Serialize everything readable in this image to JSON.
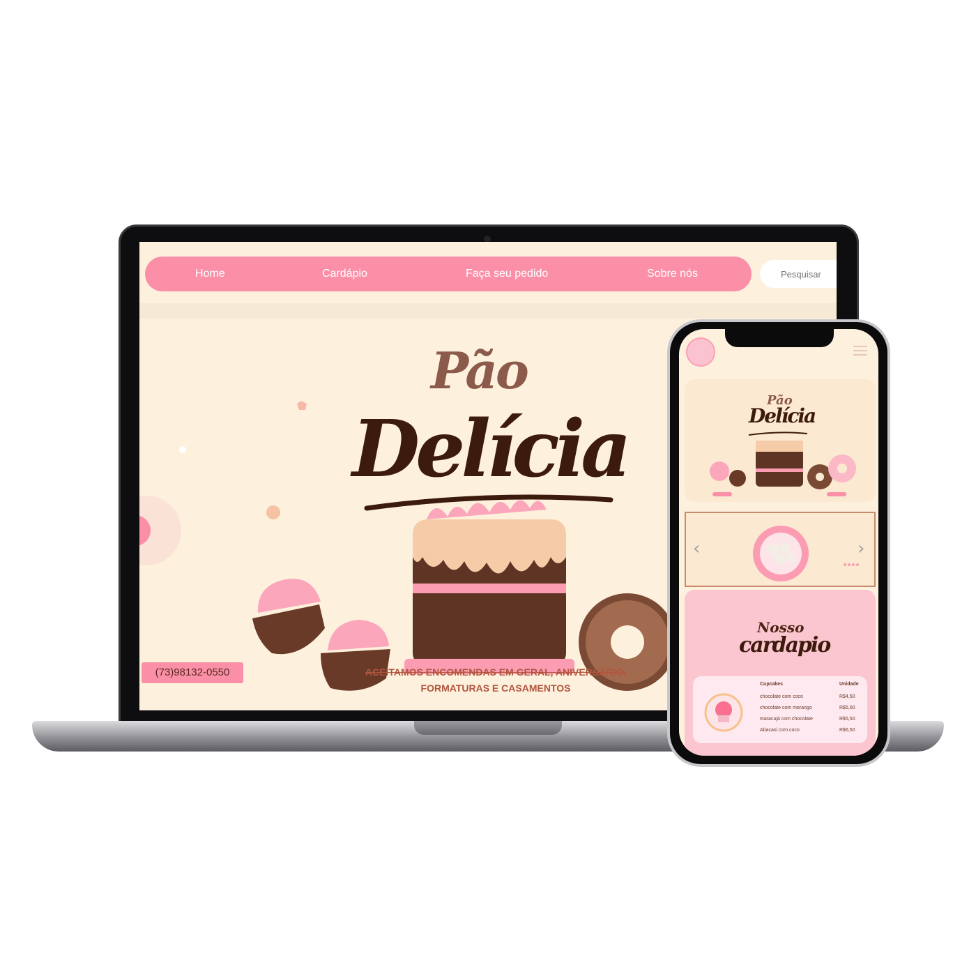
{
  "desktop": {
    "nav": [
      {
        "label": "Home"
      },
      {
        "label": "Cardápio"
      },
      {
        "label": "Faça seu pedido"
      },
      {
        "label": "Sobre nós"
      }
    ],
    "search_placeholder": "Pesquisar",
    "hero": {
      "title_line1": "Pão",
      "title_line2": "Delícia",
      "phone": "(73)98132-0550",
      "tagline_line1": "ACEITAMOS ENCOMENDAS EM GERAL, ANIVERSÁRIO,",
      "tagline_line2": "FORMATURAS E CASAMENTOS"
    }
  },
  "mobile": {
    "hero": {
      "title_line1": "Pão",
      "title_line2": "Delícia"
    },
    "carousel": {
      "prev": "‹",
      "next": "›"
    },
    "menu": {
      "title_line1": "Nosso",
      "title_line2": "cardapio",
      "col_item": "Cupcakes",
      "col_price": "Unidade",
      "items": [
        {
          "name": "chocolate com coco",
          "price": "R$4,50"
        },
        {
          "name": "chocolate com morango",
          "price": "R$5,00"
        },
        {
          "name": "maracujá com chocolate",
          "price": "R$5,50"
        },
        {
          "name": "Abacaxi com coco",
          "price": "R$6,50"
        }
      ]
    }
  },
  "colors": {
    "accent_pink": "#fb8fa8",
    "cream_bg": "#fdf1dd",
    "chocolate": "#3c1a0c"
  }
}
